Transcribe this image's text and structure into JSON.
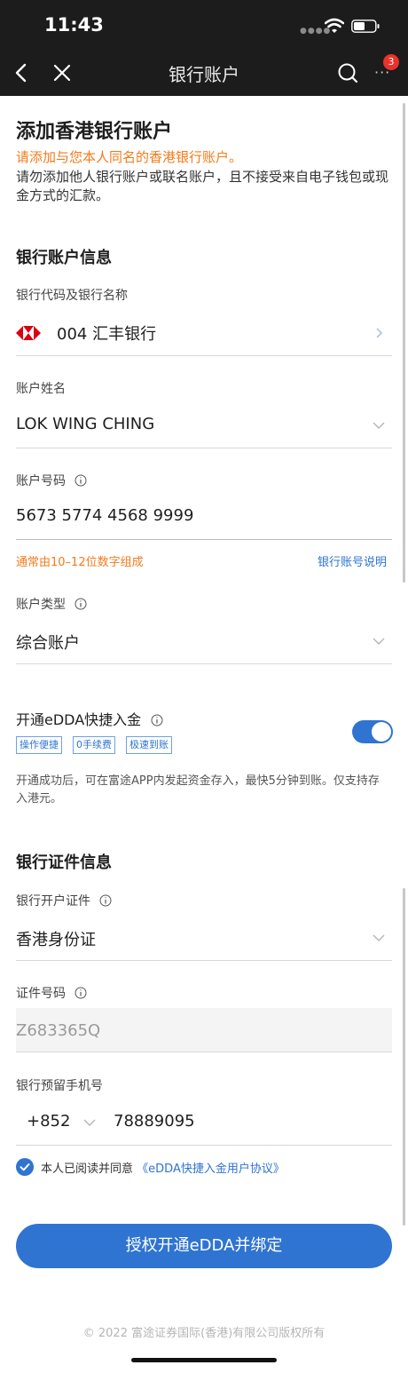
{
  "status": {
    "time": "11:43"
  },
  "nav": {
    "title": "银行账户",
    "badge": "3",
    "more": "···"
  },
  "header": {
    "title": "添加香港银行账户",
    "warning": "请添加与您本人同名的香港银行账户。",
    "note": "请勿添加他人银行账户或联名账户，且不接受来自电子钱包或现金方式的汇款。"
  },
  "bank_section": {
    "title": "银行账户信息",
    "bank_label": "银行代码及银行名称",
    "bank_value": "004 汇丰银行",
    "name_label": "账户姓名",
    "name_value": "LOK WING CHING",
    "account_label": "账户号码",
    "account_value": "5673 5774 4568 9999",
    "account_hint": "通常由10–12位数字组成",
    "account_help_link": "银行账号说明",
    "type_label": "账户类型",
    "type_value": "综合账户"
  },
  "edda": {
    "title": "开通eDDA快捷入金",
    "tags": [
      "操作便捷",
      "0手续费",
      "极速到账"
    ],
    "enabled": true,
    "description": "开通成功后，可在富途APP内发起资金存入，最快5分钟到账。仅支持存入港元。"
  },
  "id_section": {
    "title": "银行证件信息",
    "doc_label": "银行开户证件",
    "doc_value": "香港身份证",
    "id_label": "证件号码",
    "id_value": "Z683365Q",
    "phone_label": "银行预留手机号",
    "phone_code": "+852",
    "phone_number": "78889095"
  },
  "agreement": {
    "prefix": "本人已阅读并同意",
    "link": "《eDDA快捷入金用户协议》"
  },
  "submit_label": "授权开通eDDA并绑定",
  "footer": "© 2022 富途证券国际(香港)有限公司版权所有",
  "colors": {
    "accent": "#2f74d1",
    "warning": "#f27b1d",
    "bar": "#1c1c1c"
  }
}
